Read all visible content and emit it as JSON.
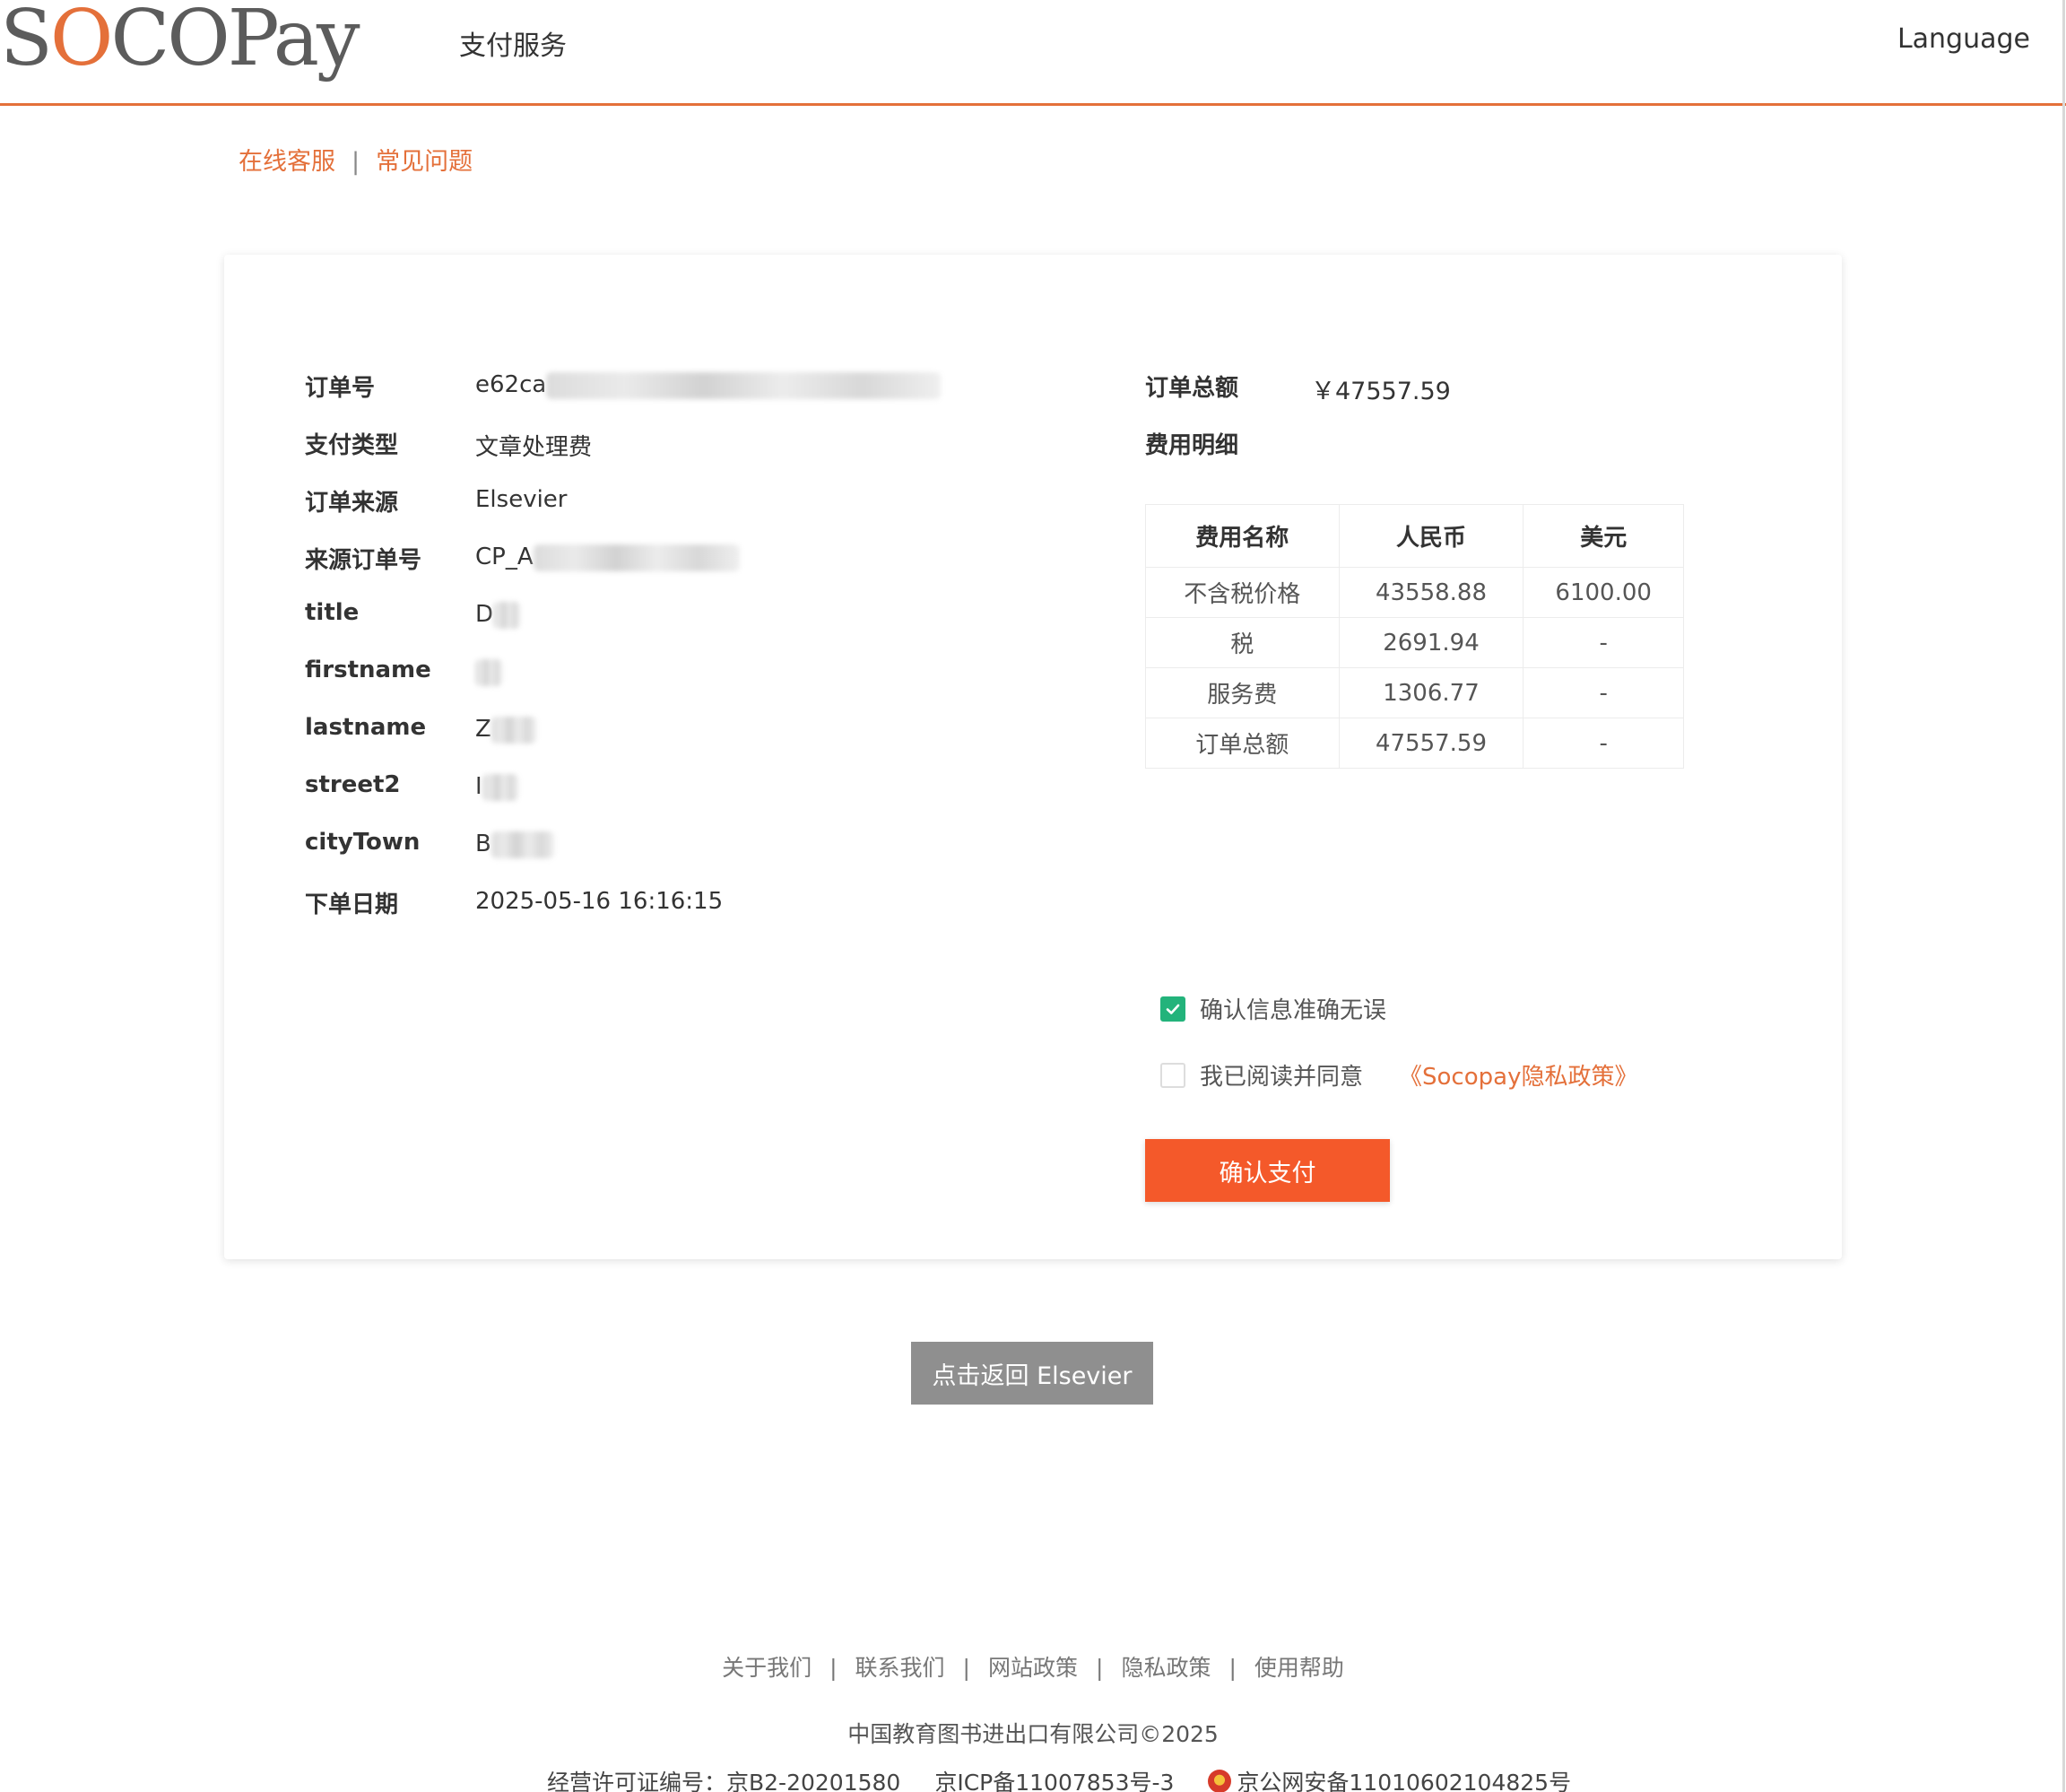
{
  "header": {
    "logo_text": "SOCOPay",
    "service_title": "支付服务",
    "language_label": "Language"
  },
  "subnav": {
    "online_service": "在线客服",
    "separator": "|",
    "faq": "常见问题"
  },
  "order_info": {
    "order_no_label": "订单号",
    "order_no_value": "e62ca",
    "payment_type_label": "支付类型",
    "payment_type_value": "文章处理费",
    "order_source_label": "订单来源",
    "order_source_value": "Elsevier",
    "source_order_no_label": "来源订单号",
    "source_order_no_value": "CP_A",
    "title_label": "title",
    "title_value": "D",
    "firstname_label": "firstname",
    "firstname_value": "",
    "lastname_label": "lastname",
    "lastname_value": "Z",
    "street2_label": "street2",
    "street2_value": "I",
    "citytown_label": "cityTown",
    "citytown_value": "B",
    "order_date_label": "下单日期",
    "order_date_value": "2025-05-16 16:16:15"
  },
  "summary": {
    "total_label": "订单总额",
    "total_value": "￥47557.59",
    "detail_label": "费用明细"
  },
  "fee_table": {
    "headers": [
      "费用名称",
      "人民币",
      "美元"
    ],
    "rows": [
      [
        "不含税价格",
        "43558.88",
        "6100.00"
      ],
      [
        "税",
        "2691.94",
        "-"
      ],
      [
        "服务费",
        "1306.77",
        "-"
      ],
      [
        "订单总额",
        "47557.59",
        "-"
      ]
    ]
  },
  "confirm": {
    "info_correct_label": "确认信息准确无误",
    "info_correct_checked": true,
    "agree_label": "我已阅读并同意",
    "agree_checked": false,
    "policy_link": "《Socopay隐私政策》",
    "pay_button": "确认支付"
  },
  "back_button": "点击返回 Elsevier",
  "footer": {
    "links": [
      "关于我们",
      "联系我们",
      "网站政策",
      "隐私政策",
      "使用帮助"
    ],
    "separator": "|",
    "copyright": "中国教育图书进出口有限公司©2025",
    "license": "经营许可证编号：京B2-20201580",
    "icp": "京ICP备11007853号-3",
    "police": "京公网安备11010602104825号"
  },
  "colors": {
    "accent": "#e4703a",
    "pay_button": "#f4592a",
    "check_green": "#23b37b",
    "back_button": "#8f8f8f"
  }
}
